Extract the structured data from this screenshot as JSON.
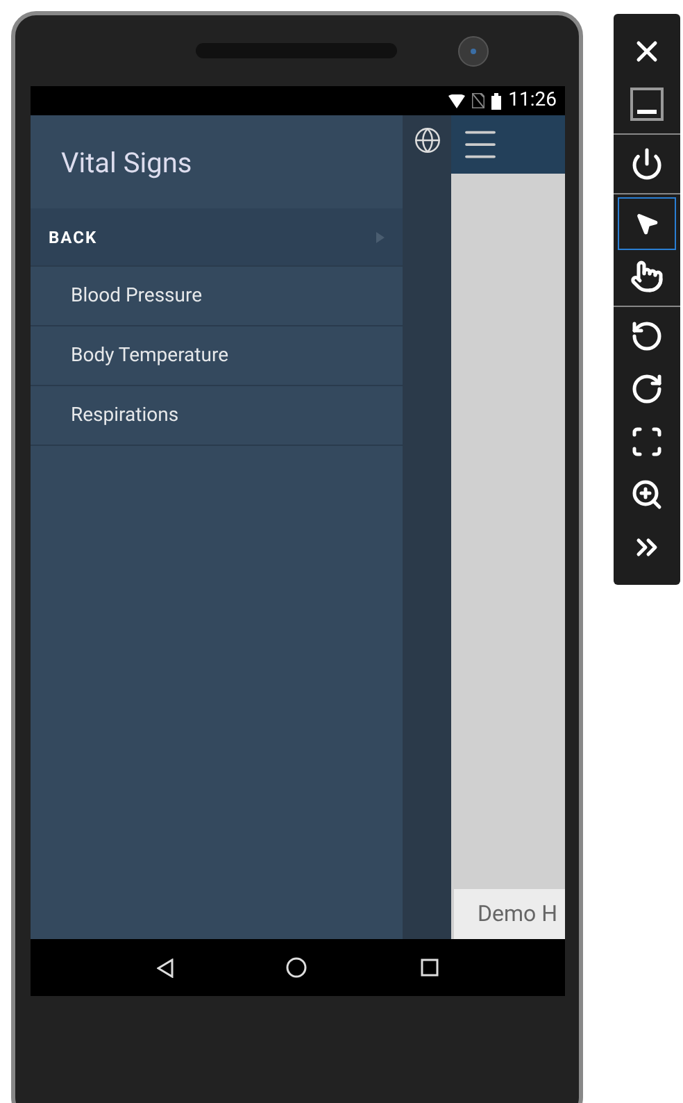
{
  "status_bar": {
    "time": "11:26"
  },
  "drawer": {
    "title": "Vital Signs",
    "back": {
      "label": "BACK"
    },
    "items": [
      {
        "label": "Blood Pressure"
      },
      {
        "label": "Body Temperature"
      },
      {
        "label": "Respirations"
      }
    ]
  },
  "content": {
    "tab": "Demo H"
  },
  "toolbar": [
    {
      "kind": "close",
      "selected": false,
      "divider_after": false
    },
    {
      "kind": "minimize",
      "selected": false,
      "divider_after": true
    },
    {
      "kind": "power",
      "selected": false,
      "divider_after": true
    },
    {
      "kind": "pointer",
      "selected": true,
      "divider_after": false
    },
    {
      "kind": "touch",
      "selected": false,
      "divider_after": true
    },
    {
      "kind": "rotate-left",
      "selected": false,
      "divider_after": false
    },
    {
      "kind": "rotate-right",
      "selected": false,
      "divider_after": false
    },
    {
      "kind": "fit",
      "selected": false,
      "divider_after": false
    },
    {
      "kind": "zoom",
      "selected": false,
      "divider_after": false
    },
    {
      "kind": "more",
      "selected": false,
      "divider_after": false
    }
  ]
}
